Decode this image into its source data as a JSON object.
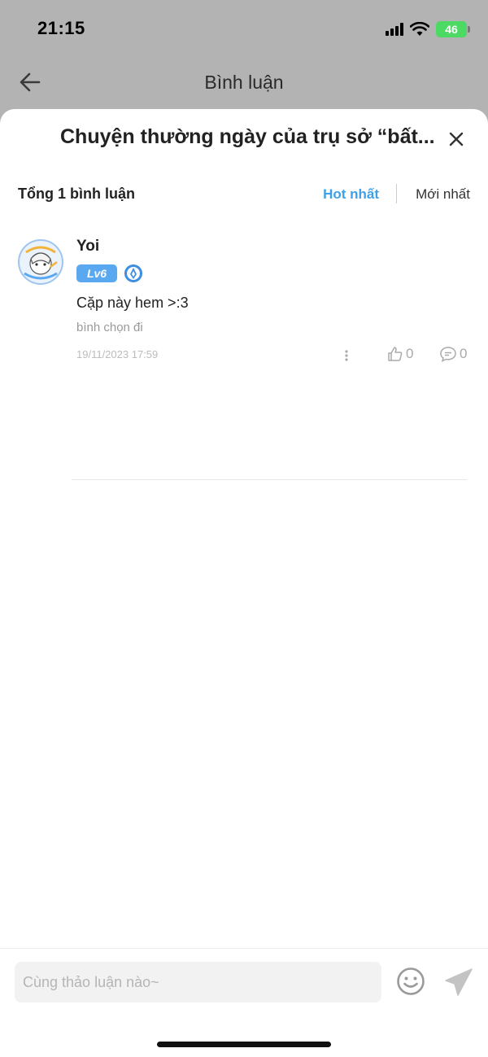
{
  "status_bar": {
    "time": "21:15",
    "battery": "46"
  },
  "header": {
    "title": "Bình luận"
  },
  "sheet": {
    "title": "Chuyện thường ngày của trụ sở “bất...",
    "total_label": "Tổng 1 bình luận",
    "sort_options": [
      "Hot nhất",
      "Mới nhất"
    ],
    "active_sort": "Hot nhất"
  },
  "comments": [
    {
      "user": "Yoi",
      "level": "Lv6",
      "text": "Cặp này hem >:3",
      "sub": "bình chọn đi",
      "date": "19/11/2023 17:59",
      "likes": "0",
      "replies": "0"
    }
  ],
  "input": {
    "placeholder": "Cùng thảo luận nào~"
  },
  "colors": {
    "accent": "#3ea0e6",
    "level_badge": "#5aa9f0",
    "battery": "#4cd964"
  }
}
